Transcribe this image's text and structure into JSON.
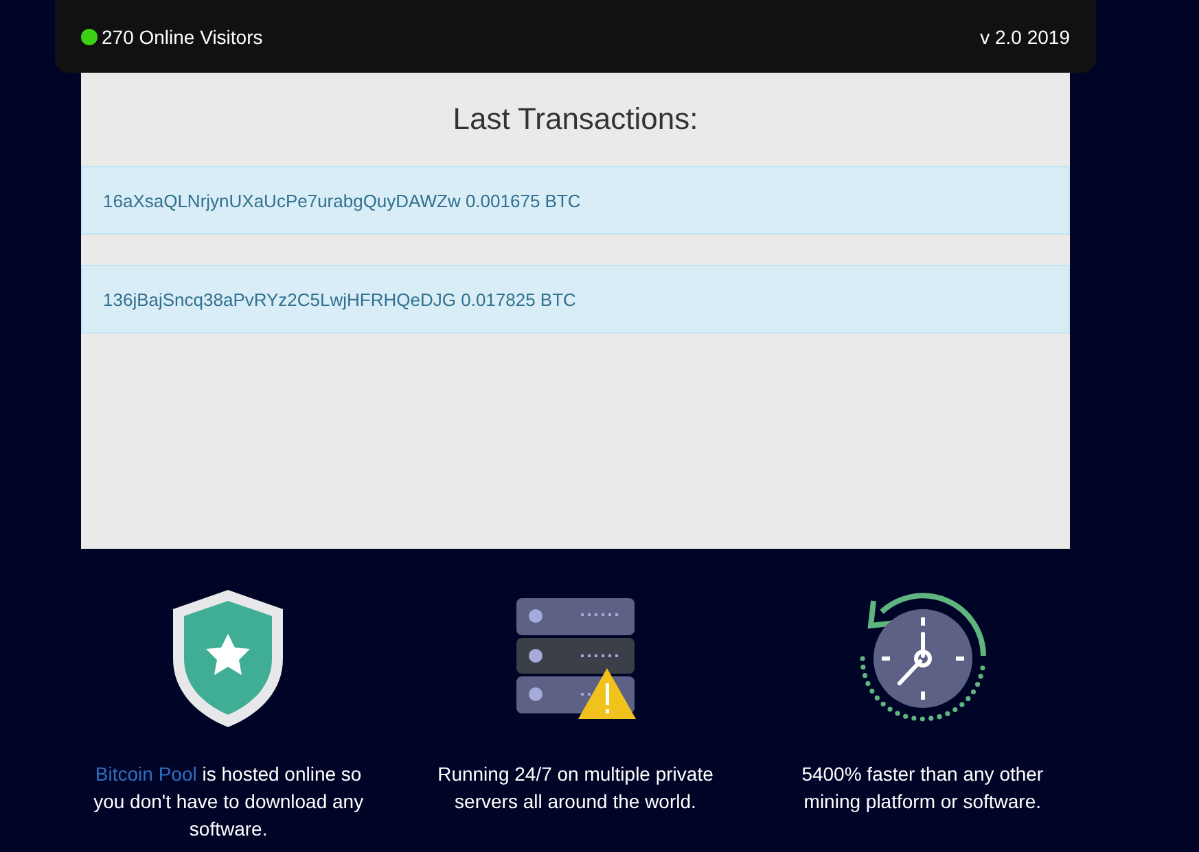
{
  "top_bar": {
    "online_on": true,
    "visitors": "270 Online Visitors",
    "version": "v 2.0 2019"
  },
  "transactions": {
    "title": "Last Transactions:",
    "rows": [
      {
        "text": "16aXsaQLNrjynUXaUcPe7urabgQuyDAWZw 0.001675 BTC"
      },
      {
        "text": "136jBajSncq38aPvRYz2C5LwjHFRHQeDJG 0.017825 BTC"
      }
    ]
  },
  "features": [
    {
      "kind": "shield",
      "link": "Bitcoin Pool",
      "text": " is hosted online so you don't have to download any software."
    },
    {
      "kind": "server",
      "text": "Running 24/7 on multiple private servers all around the world."
    },
    {
      "kind": "clock",
      "text": "5400% faster than any other mining platform or software."
    }
  ]
}
